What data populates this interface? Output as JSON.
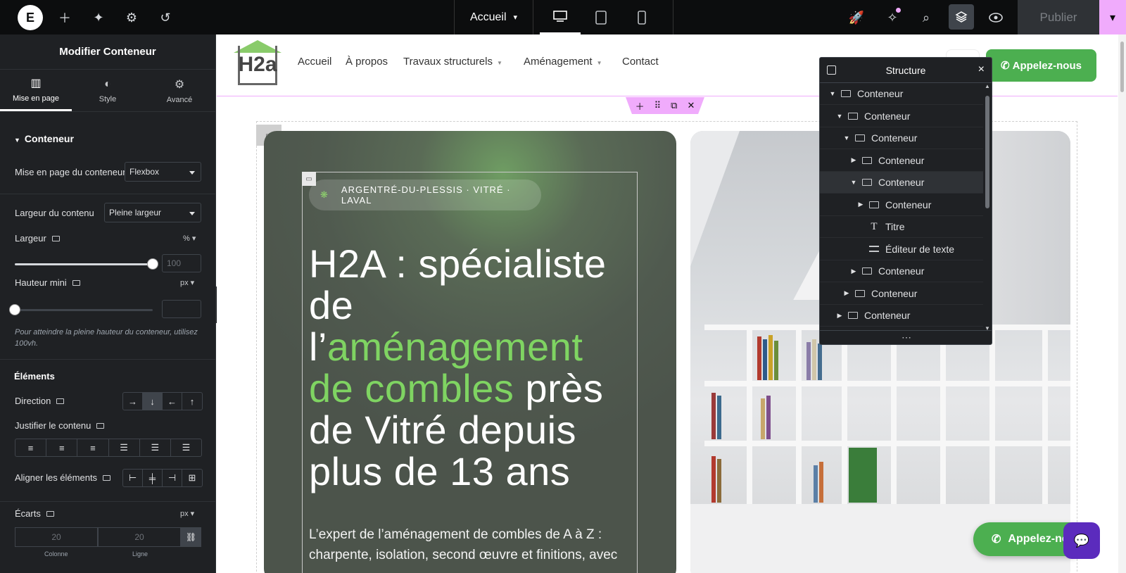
{
  "topbar": {
    "logo": "E",
    "page_selector": "Accueil",
    "publish_label": "Publier"
  },
  "panel": {
    "title": "Modifier Conteneur",
    "tabs": [
      {
        "label": "Mise en page",
        "icon": "layout-icon"
      },
      {
        "label": "Style",
        "icon": "contrast-icon"
      },
      {
        "label": "Avancé",
        "icon": "gear-icon"
      }
    ],
    "section_title": "Conteneur",
    "layout_label": "Mise en page du conteneur",
    "layout_value": "Flexbox",
    "content_width_label": "Largeur du contenu",
    "content_width_value": "Pleine largeur",
    "width_label": "Largeur",
    "width_unit": "%",
    "width_placeholder": "100",
    "width_slider_value": 1.0,
    "min_height_label": "Hauteur mini",
    "min_height_unit": "px",
    "min_height_slider_value": 0.0,
    "min_height_hint": "Pour atteindre la pleine hauteur du conteneur, utilisez 100vh.",
    "elements_title": "Éléments",
    "direction_label": "Direction",
    "justify_label": "Justifier le contenu",
    "align_label": "Aligner les éléments",
    "gaps_label": "Écarts",
    "gaps_unit": "px",
    "gap_column_placeholder": "20",
    "gap_row_placeholder": "20",
    "gap_column_label": "Colonne",
    "gap_row_label": "Ligne"
  },
  "site": {
    "logo_text": "H2a",
    "nav": [
      {
        "label": "Accueil",
        "has_caret": false
      },
      {
        "label": "À propos",
        "has_caret": false
      },
      {
        "label": "Travaux structurels",
        "has_caret": true
      },
      {
        "label": "Aménagement",
        "has_caret": true
      },
      {
        "label": "Contact",
        "has_caret": false
      }
    ],
    "cta_top": "Appelez-nous",
    "badge": "ARGENTRÉ-DU-PLESSIS · VITRÉ · LAVAL",
    "headline_part1": "H2A : spécialiste de l’",
    "headline_highlight": "aménagement de combles",
    "headline_part2": " près de Vitré depuis plus de 13 ans",
    "lead": "L’expert de l’aménagement de combles de A à Z : charpente, isolation, second œuvre et finitions, avec",
    "cta_float": "Appelez-no"
  },
  "structure": {
    "title": "Structure",
    "rows": [
      {
        "label": "Conteneur",
        "type": "container",
        "level": 0,
        "arrow": "down"
      },
      {
        "label": "Conteneur",
        "type": "container",
        "level": 1,
        "arrow": "down"
      },
      {
        "label": "Conteneur",
        "type": "container",
        "level": 2,
        "arrow": "down"
      },
      {
        "label": "Conteneur",
        "type": "container",
        "level": 3,
        "arrow": "right"
      },
      {
        "label": "Conteneur",
        "type": "container",
        "level": 3,
        "arrow": "down",
        "highlight": true
      },
      {
        "label": "Conteneur",
        "type": "container",
        "level": 4,
        "arrow": "right"
      },
      {
        "label": "Titre",
        "type": "heading",
        "level": 4,
        "arrow": ""
      },
      {
        "label": "Éditeur de texte",
        "type": "text",
        "level": 4,
        "arrow": ""
      },
      {
        "label": "Conteneur",
        "type": "container",
        "level": 3,
        "arrow": "right"
      },
      {
        "label": "Conteneur",
        "type": "container",
        "level": 2,
        "arrow": "right"
      },
      {
        "label": "Conteneur",
        "type": "container",
        "level": 1,
        "arrow": "right"
      }
    ],
    "footer": "⋯"
  },
  "colors": {
    "accent_pink": "#f0abfc",
    "cta_green": "#4caf50",
    "highlight_green": "#7fd462",
    "panel_bg": "#1f2124"
  }
}
